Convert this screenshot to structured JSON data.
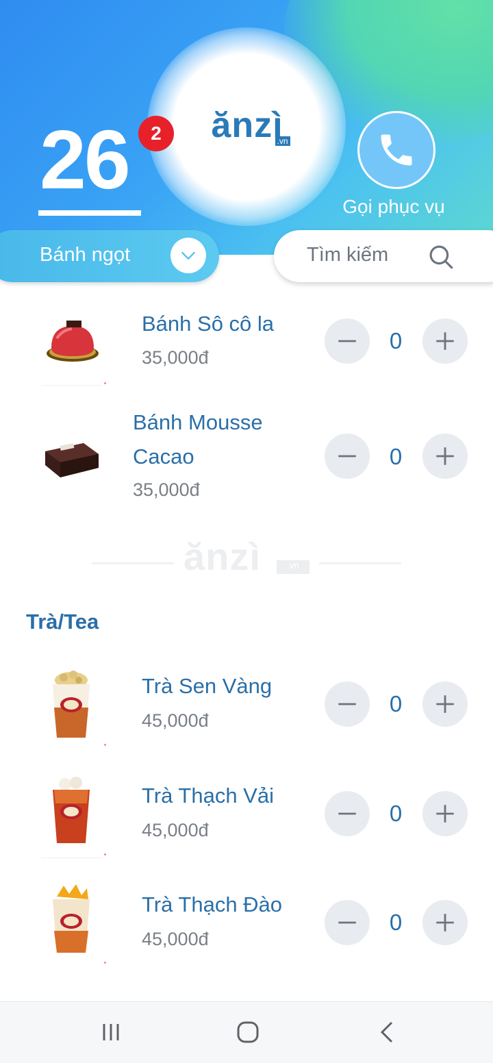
{
  "header": {
    "table_number": "26",
    "badge_count": "2",
    "logo_text": "ănzì",
    "logo_suffix": ".vn",
    "call_label": "Gọi phục vụ"
  },
  "toolbar": {
    "category_selected": "Bánh ngọt",
    "search_placeholder": "Tìm kiếm"
  },
  "menu": {
    "cakes": [
      {
        "name": "Bánh Sô cô la",
        "price": "35,000đ",
        "quantity": "0",
        "icon": "chocolate-cake-icon"
      },
      {
        "name": "Bánh Mousse Cacao",
        "price": "35,000đ",
        "quantity": "0",
        "icon": "mousse-cake-icon"
      }
    ],
    "divider_logo": "ănzì",
    "divider_suffix": ".vn",
    "tea_section_title": "Trà/Tea",
    "teas": [
      {
        "name": "Trà Sen Vàng",
        "price": "45,000đ",
        "quantity": "0",
        "icon": "lotus-tea-cup-icon"
      },
      {
        "name": "Trà Thạch Vải",
        "price": "45,000đ",
        "quantity": "0",
        "icon": "lychee-tea-cup-icon"
      },
      {
        "name": "Trà Thạch Đào",
        "price": "45,000đ",
        "quantity": "0",
        "icon": "peach-tea-cup-icon"
      }
    ]
  },
  "colors": {
    "accent_blue": "#2a6fa8",
    "badge_red": "#e8202a",
    "header_blue": "#2f8cf0",
    "header_green": "#62e0a8"
  },
  "nav": {
    "icons": [
      "recent-apps-icon",
      "home-icon",
      "back-icon"
    ]
  }
}
